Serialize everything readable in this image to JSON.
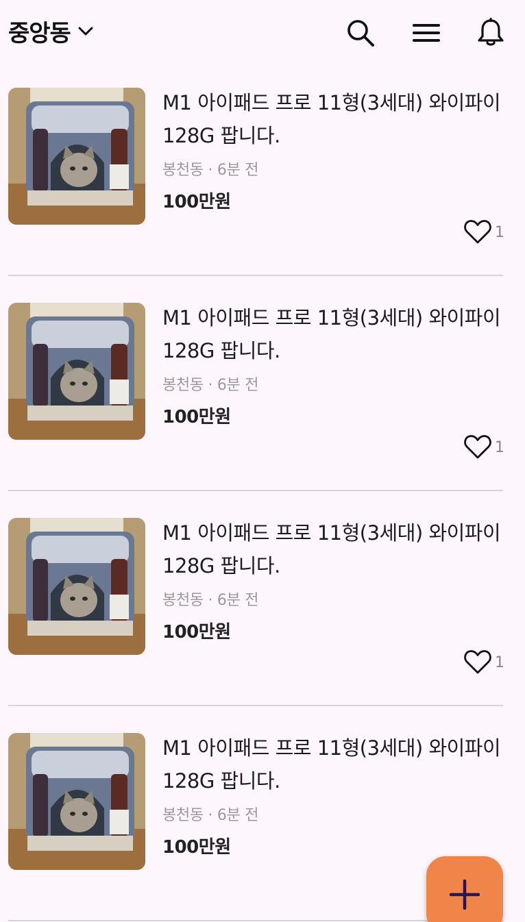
{
  "header": {
    "location": "중앙동",
    "icons": [
      "chevron-down-icon",
      "search-icon",
      "menu-icon",
      "bell-icon"
    ]
  },
  "items": [
    {
      "title": "M1 아이패드 프로 11형(3세대) 와이파이 128G 팝니다.",
      "meta": "봉천동 · 6분 전",
      "price": "100만원",
      "likes": "1"
    },
    {
      "title": "M1 아이패드 프로 11형(3세대) 와이파이 128G 팝니다.",
      "meta": "봉천동 · 6분 전",
      "price": "100만원",
      "likes": "1"
    },
    {
      "title": "M1 아이패드 프로 11형(3세대) 와이파이 128G 팝니다.",
      "meta": "봉천동 · 6분 전",
      "price": "100만원",
      "likes": "1"
    },
    {
      "title": "M1 아이패드 프로 11형(3세대) 와이파이 128G 팝니다.",
      "meta": "봉천동 · 6분 전",
      "price": "100만원",
      "likes": ""
    }
  ],
  "fab": {
    "icon": "plus-icon",
    "color": "#f0854a",
    "icon_color": "#2a1454"
  },
  "colors": {
    "background": "#fdf7fd",
    "divider": "#d6d4d8",
    "meta_text": "#9a9a9a"
  }
}
